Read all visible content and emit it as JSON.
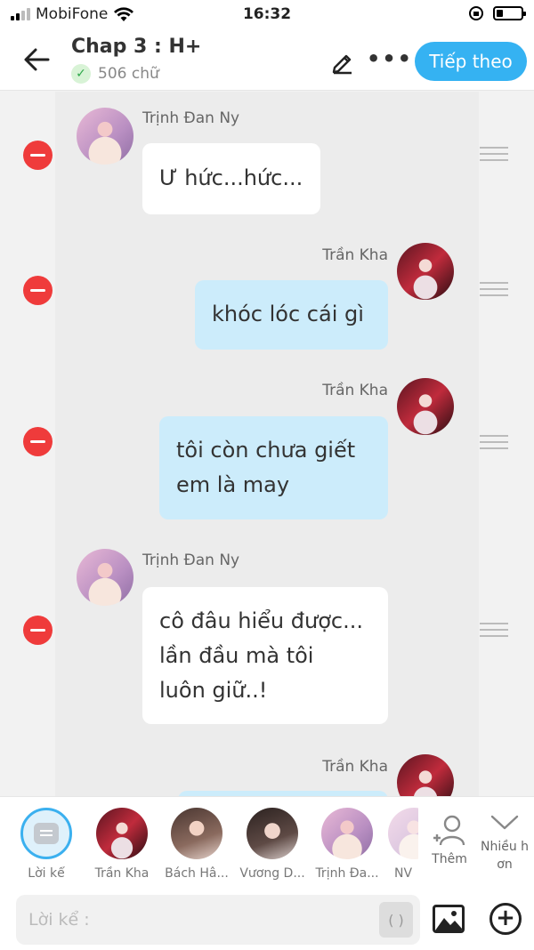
{
  "status_bar": {
    "carrier": "MobiFone",
    "time": "16:32"
  },
  "header": {
    "title": "Chap 3 : H+",
    "word_count": "506 chữ",
    "next_label": "Tiếp theo"
  },
  "messages": [
    {
      "speaker": "Trịnh Đan Ny",
      "side": "left",
      "avatar": "ny",
      "lines": [
        "Ư hức...hức..."
      ]
    },
    {
      "speaker": "Trần Kha",
      "side": "right",
      "avatar": "kha",
      "lines": [
        "khóc lóc cái gì"
      ]
    },
    {
      "speaker": "Trần Kha",
      "side": "right",
      "avatar": "kha",
      "lines": [
        "tôi còn chưa giết",
        "em là may"
      ]
    },
    {
      "speaker": "Trịnh Đan Ny",
      "side": "left",
      "avatar": "ny",
      "lines": [
        "cô đâu hiểu được...",
        "lần đầu mà tôi",
        "luôn giữ..!"
      ]
    },
    {
      "speaker": "Trần Kha",
      "side": "right",
      "avatar": "kha",
      "lines": [
        ""
      ]
    }
  ],
  "characters": [
    {
      "label": "Lời kể",
      "type": "narration"
    },
    {
      "label": "Trần Kha",
      "type": "kha"
    },
    {
      "label": "Bách Hâ...",
      "type": "bach"
    },
    {
      "label": "Vương D...",
      "type": "vuong"
    },
    {
      "label": "Trịnh Đa...",
      "type": "ny"
    },
    {
      "label": "NV",
      "type": "nv"
    }
  ],
  "add_character_label": "Thêm",
  "more_label": "Nhiều h ơn",
  "composer": {
    "placeholder": "Lời kể :",
    "paren_label": "( )"
  }
}
